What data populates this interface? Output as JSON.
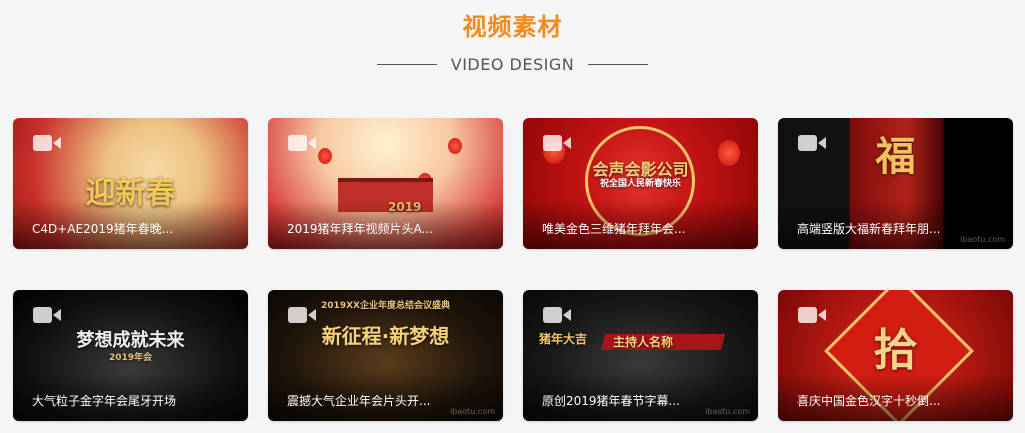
{
  "section": {
    "title": "视频素材",
    "subtitle": "VIDEO DESIGN"
  },
  "cards": [
    {
      "caption": "C4D+AE2019猪年春晚...",
      "art_text": "迎新春"
    },
    {
      "caption": "2019猪年拜年视频片头A...",
      "art_text": "2019"
    },
    {
      "caption": "唯美金色三维猪年拜年会...",
      "art_text": "会声会影公司",
      "art_sub": "祝全国人民新春快乐"
    },
    {
      "caption": "高端竖版大福新春拜年朋...",
      "art_text": "福"
    },
    {
      "caption": "大气粒子金字年会尾牙开场",
      "art_text": "梦想成就未来",
      "art_sub": "2019年会"
    },
    {
      "caption": "震撼大气企业年会片头开...",
      "art_text": "新征程·新梦想",
      "art_sub": "2019XX企业年度总结会议盛典"
    },
    {
      "caption": "原创2019猪年春节字幕...",
      "art_text": "主持人名称",
      "art_sub": "猪年大吉"
    },
    {
      "caption": "喜庆中国金色汉字十秒倒...",
      "art_text": "拾"
    }
  ],
  "watermark": "ibaotu.com",
  "colors": {
    "accent": "#f08c1e",
    "background": "#f5f5f5"
  },
  "icons": {
    "play": "video-camera-icon"
  }
}
